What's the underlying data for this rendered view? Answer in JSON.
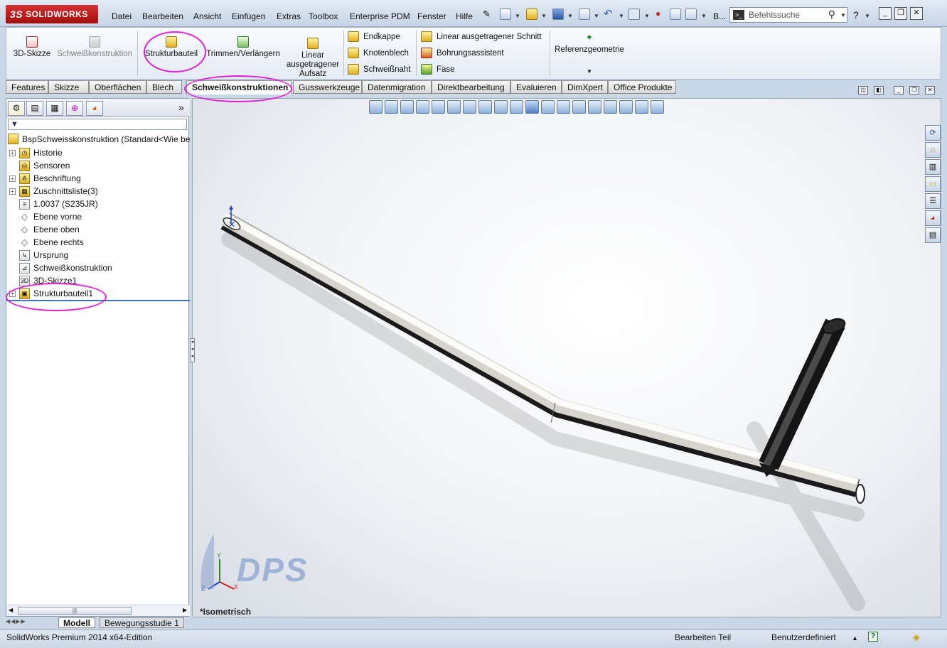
{
  "title_bar": {
    "app_logo": "SOLIDWORKS",
    "menus": [
      "Datei",
      "Bearbeiten",
      "Ansicht",
      "Einfügen",
      "Extras",
      "Toolbox",
      "Enterprise PDM",
      "Fenster",
      "Hilfe"
    ],
    "overflow_label": "B...",
    "search_placeholder": "Befehlssuche",
    "help_label": "?"
  },
  "command_manager": {
    "sketch3d": "3D-Skizze",
    "weldment": "Schweißkonstruktion",
    "structural_member": "Strukturbauteil",
    "trim_extend": "Trimmen/Verlängern",
    "linear_boss": [
      "Linear",
      "ausgetragener",
      "Aufsatz"
    ],
    "end_cap": "Endkappe",
    "gusset": "Knotenblech",
    "weld_bead": "Schweißnaht",
    "linear_cut": "Linear ausgetragener Schnitt",
    "hole_wizard": "Bohrungsassistent",
    "chamfer": "Fase",
    "reference_geometry": "Referenzgeometrie"
  },
  "tabs": [
    "Features",
    "Skizze",
    "Oberflächen",
    "Blech",
    "Schweißkonstruktionen",
    "Gusswerkzeuge",
    "Datenmigration",
    "Direktbearbeitung",
    "Evaluieren",
    "DimXpert",
    "Office Produkte"
  ],
  "active_tab_index": 4,
  "feature_tree": {
    "root": "BspSchweisskonstruktion  (Standard<Wie be",
    "expand_symbol": "»",
    "nodes": [
      {
        "label": "Historie",
        "icon": "history-icon",
        "expandable": true
      },
      {
        "label": "Sensoren",
        "icon": "sensor-icon",
        "expandable": false
      },
      {
        "label": "Beschriftung",
        "icon": "annotation-icon",
        "expandable": true
      },
      {
        "label": "Zuschnittsliste(3)",
        "icon": "cut-list-icon",
        "expandable": true
      },
      {
        "label": "1.0037 (S235JR)",
        "icon": "material-icon",
        "expandable": false
      },
      {
        "label": "Ebene vorne",
        "icon": "plane-icon",
        "expandable": false
      },
      {
        "label": "Ebene oben",
        "icon": "plane-icon",
        "expandable": false
      },
      {
        "label": "Ebene rechts",
        "icon": "plane-icon",
        "expandable": false
      },
      {
        "label": "Ursprung",
        "icon": "origin-icon",
        "expandable": false
      },
      {
        "label": "Schweißkonstruktion",
        "icon": "weldment-icon",
        "expandable": false
      },
      {
        "label": "3D-Skizze1",
        "icon": "sketch3d-icon",
        "expandable": false
      },
      {
        "label": "Strukturbauteil1",
        "icon": "structural-member-icon",
        "expandable": true
      }
    ]
  },
  "bottom_tabs": [
    "Modell",
    "Bewegungsstudie 1"
  ],
  "viewport": {
    "view_name": "*Isometrisch",
    "watermark": "DPS",
    "axes": {
      "x": "X",
      "y": "Y",
      "z": "Z"
    }
  },
  "status_bar": {
    "product": "SolidWorks Premium 2014 x64-Edition",
    "mode": "Bearbeiten Teil",
    "units": "Benutzerdefiniert"
  },
  "colors": {
    "highlight": "#e020d6",
    "logo_red": "#c21d1d",
    "selection_line": "#3d70c8"
  }
}
